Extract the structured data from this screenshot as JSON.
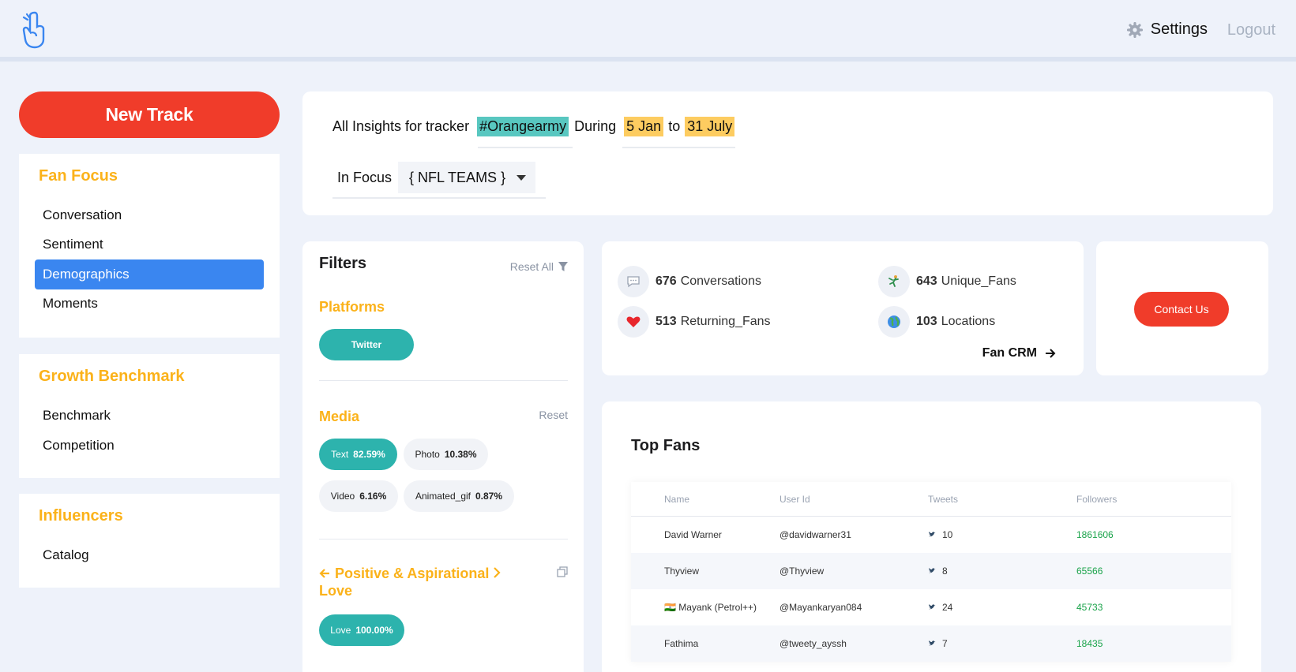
{
  "header": {
    "settings_label": "Settings",
    "logout_label": "Logout",
    "accent_color": "#3a86f0"
  },
  "sidebar": {
    "new_track_label": "New Track",
    "sections": [
      {
        "title": "Fan Focus",
        "items": [
          {
            "label": "Conversation"
          },
          {
            "label": "Sentiment"
          },
          {
            "label": "Demographics",
            "active": true
          },
          {
            "label": "Moments"
          }
        ]
      },
      {
        "title": "Growth Benchmark",
        "items": [
          {
            "label": "Benchmark"
          },
          {
            "label": "Competition"
          }
        ]
      },
      {
        "title": "Influencers",
        "items": [
          {
            "label": "Catalog"
          }
        ]
      }
    ]
  },
  "insights": {
    "prefix": "All Insights for tracker",
    "tracker": "#Orangearmy",
    "during": "During",
    "start_date": "5 Jan",
    "to": "to",
    "end_date": "31 July",
    "in_focus_label": "In Focus",
    "in_focus_value": "{ NFL TEAMS }"
  },
  "filters": {
    "title": "Filters",
    "reset_all": "Reset All",
    "platforms": {
      "title": "Platforms",
      "chips": [
        {
          "label": "Twitter",
          "selected": true
        }
      ]
    },
    "media": {
      "title": "Media",
      "reset": "Reset",
      "chips": [
        {
          "label": "Text",
          "value": "82.59%",
          "selected": true
        },
        {
          "label": "Photo",
          "value": "10.38%",
          "selected": false
        },
        {
          "label": "Video",
          "value": "6.16%",
          "selected": false
        },
        {
          "label": "Animated_gif",
          "value": "0.87%",
          "selected": false
        }
      ]
    },
    "emotion": {
      "title": "Positive & Aspirational Love",
      "chips": [
        {
          "label": "Love",
          "value": "100.00%",
          "selected": true
        }
      ]
    }
  },
  "stats": {
    "conversations": {
      "value": "676",
      "label": "Conversations",
      "icon": "speech-bubble-icon"
    },
    "unique_fans": {
      "value": "643",
      "label": "Unique_Fans",
      "icon": "fan-icon"
    },
    "returning_fans": {
      "value": "513",
      "label": "Returning_Fans",
      "icon": "heart-icon"
    },
    "locations": {
      "value": "103",
      "label": "Locations",
      "icon": "globe-icon"
    },
    "fan_crm_label": "Fan CRM"
  },
  "contact": {
    "label": "Contact Us"
  },
  "top_fans": {
    "title": "Top Fans",
    "columns": [
      "Name",
      "User Id",
      "Tweets",
      "Followers"
    ],
    "rows": [
      {
        "name": "David Warner",
        "user_id": "@davidwarner31",
        "tweets": "10",
        "followers": "1861606"
      },
      {
        "name": "🇮🇳 Mayank (Petrol++)",
        "user_id": "@Mayankaryan084",
        "tweets": "24",
        "followers": "45733"
      },
      {
        "name": "Thyview",
        "user_id": "@Thyview",
        "tweets": "8",
        "followers": "65566"
      },
      {
        "name": "Fathima",
        "user_id": "@tweety_ayssh",
        "tweets": "7",
        "followers": "18435"
      }
    ]
  }
}
